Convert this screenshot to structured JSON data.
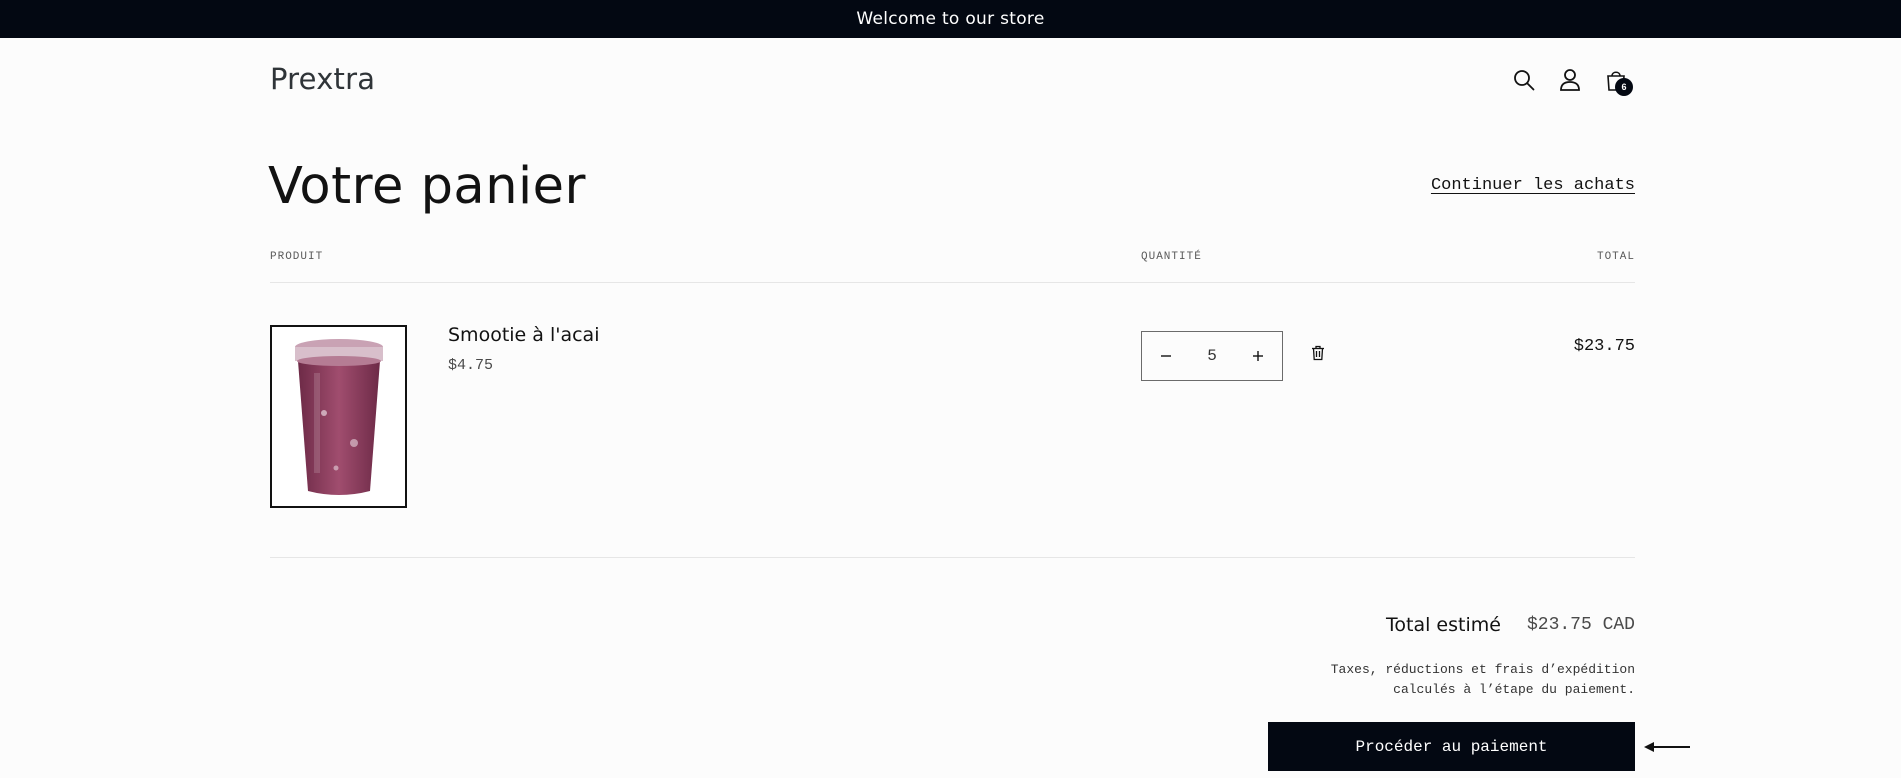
{
  "announcement": {
    "text": "Welcome to our store"
  },
  "header": {
    "logo": "Prextra",
    "icons": {
      "search": "search-icon",
      "account": "account-icon",
      "cart": "cart-icon"
    },
    "cart_count": "6"
  },
  "cart": {
    "title": "Votre panier",
    "continue_label": "Continuer les achats",
    "columns": {
      "product": "PRODUIT",
      "quantity": "QUANTITÉ",
      "total": "TOTAL"
    },
    "items": [
      {
        "name": "Smootie à l'acai",
        "unit_price": "$4.75",
        "quantity": "5",
        "line_total": "$23.75",
        "decrease_icon": "minus-icon",
        "increase_icon": "plus-icon",
        "remove_icon": "trash-icon"
      }
    ],
    "estimated_total_label": "Total estimé",
    "estimated_total_value": "$23.75 CAD",
    "tax_note_line1": "Taxes, réductions et frais d’expédition",
    "tax_note_line2": "calculés à l’étape du paiement.",
    "checkout_label": "Procéder au paiement"
  },
  "colors": {
    "dark": "#030812",
    "text": "#121212",
    "background": "#fcfcfc",
    "smoothie": "#8b3a5e"
  }
}
